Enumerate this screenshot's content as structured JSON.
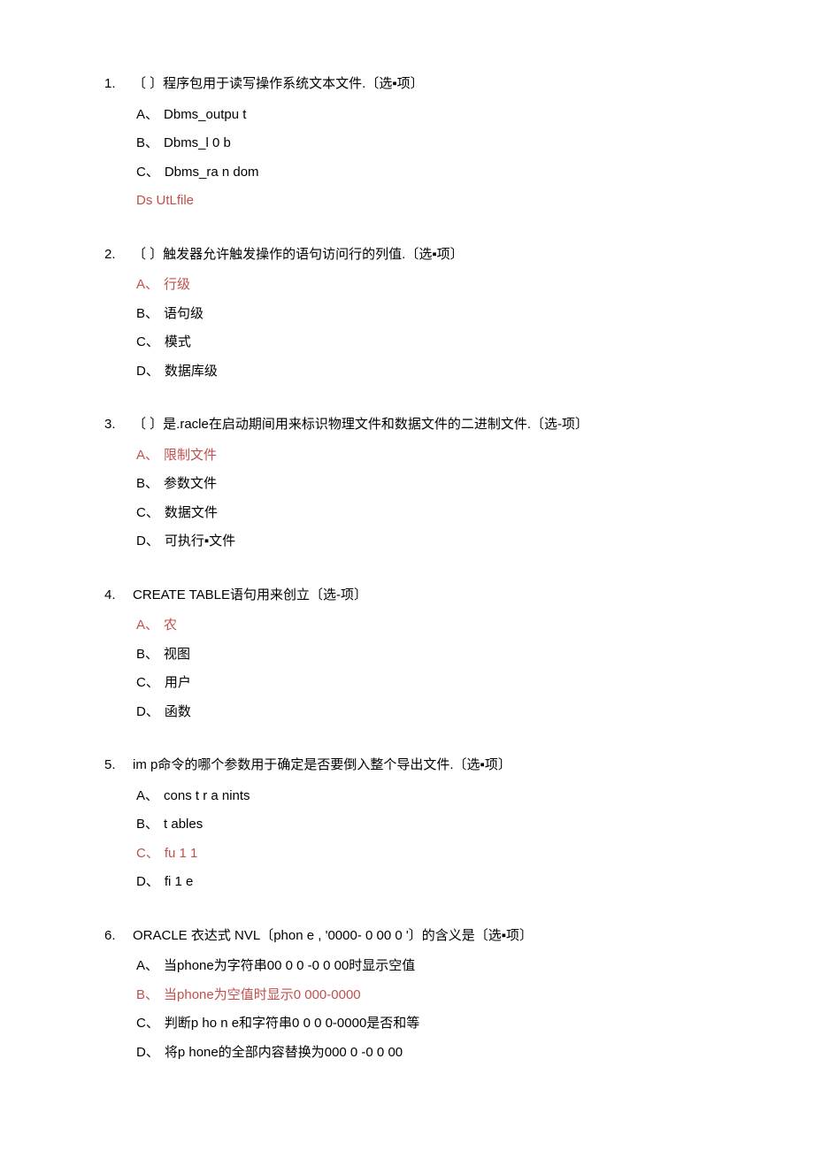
{
  "questions": [
    {
      "num": "1.",
      "stem": "〔 〕程序包用于读写操作系统文本文件.〔选▪项〕",
      "options": [
        {
          "label": "A、",
          "text": "Dbms_outpu t",
          "answer": false
        },
        {
          "label": "B、",
          "text": "Dbms_l 0 b",
          "answer": false
        },
        {
          "label": "C、",
          "text": "Dbms_ra n dom",
          "answer": false
        }
      ],
      "extra": "Ds UtLfile",
      "extra_answer": true
    },
    {
      "num": "2.",
      "stem": "〔 〕触发器允许触发操作的语句访问行的列值.〔选▪项〕",
      "options": [
        {
          "label": "A、",
          "text": "行级",
          "answer": true
        },
        {
          "label": "B、",
          "text": "语句级",
          "answer": false
        },
        {
          "label": "C、",
          "text": "模式",
          "answer": false
        },
        {
          "label": "D、",
          "text": "数据库级",
          "answer": false
        }
      ]
    },
    {
      "num": "3.",
      "stem": "〔 〕是.racle在启动期间用来标识物理文件和数据文件的二进制文件.〔选-项〕",
      "options": [
        {
          "label": "A、",
          "text": "限制文件",
          "answer": true
        },
        {
          "label": "B、",
          "text": "参数文件",
          "answer": false
        },
        {
          "label": "C、",
          "text": "数据文件",
          "answer": false
        },
        {
          "label": "D、",
          "text": "可执行▪文件",
          "answer": false
        }
      ]
    },
    {
      "num": "4.",
      "stem": "CREATE TABLE语句用来创立〔选-项〕",
      "options": [
        {
          "label": "A、",
          "text": "农",
          "answer": true
        },
        {
          "label": "B、",
          "text": "视图",
          "answer": false
        },
        {
          "label": "C、",
          "text": "用户",
          "answer": false
        },
        {
          "label": "D、",
          "text": "函数",
          "answer": false
        }
      ]
    },
    {
      "num": "5.",
      "stem": "im p命令的哪个参数用于确定是否要倒入整个导出文件.〔选▪项〕",
      "options": [
        {
          "label": "A、",
          "text": "cons t r a nints",
          "answer": false
        },
        {
          "label": "B、",
          "text": "t ables",
          "answer": false
        },
        {
          "label": "C、",
          "text": "fu 1 1",
          "answer": true
        },
        {
          "label": "D、",
          "text": "fi 1 e",
          "answer": false
        }
      ]
    },
    {
      "num": "6.",
      "stem": "ORACLE 衣达式 NVL〔phon e , '0000- 0 00 0 '〕的含义是〔选▪项〕",
      "options": [
        {
          "label": "A、",
          "text": "当phone为字符串00 0 0 -0 0 00时显示空值",
          "answer": false
        },
        {
          "label": "B、",
          "text": "当phone为空值时显示0 000-0000",
          "answer": true
        },
        {
          "label": "C、",
          "text": "判断p ho n e和字符串0 0 0 0-0000是否和等",
          "answer": false
        },
        {
          "label": "D、",
          "text": "将p hone的全部内容替换为000 0 -0 0 00",
          "answer": false
        }
      ]
    }
  ]
}
